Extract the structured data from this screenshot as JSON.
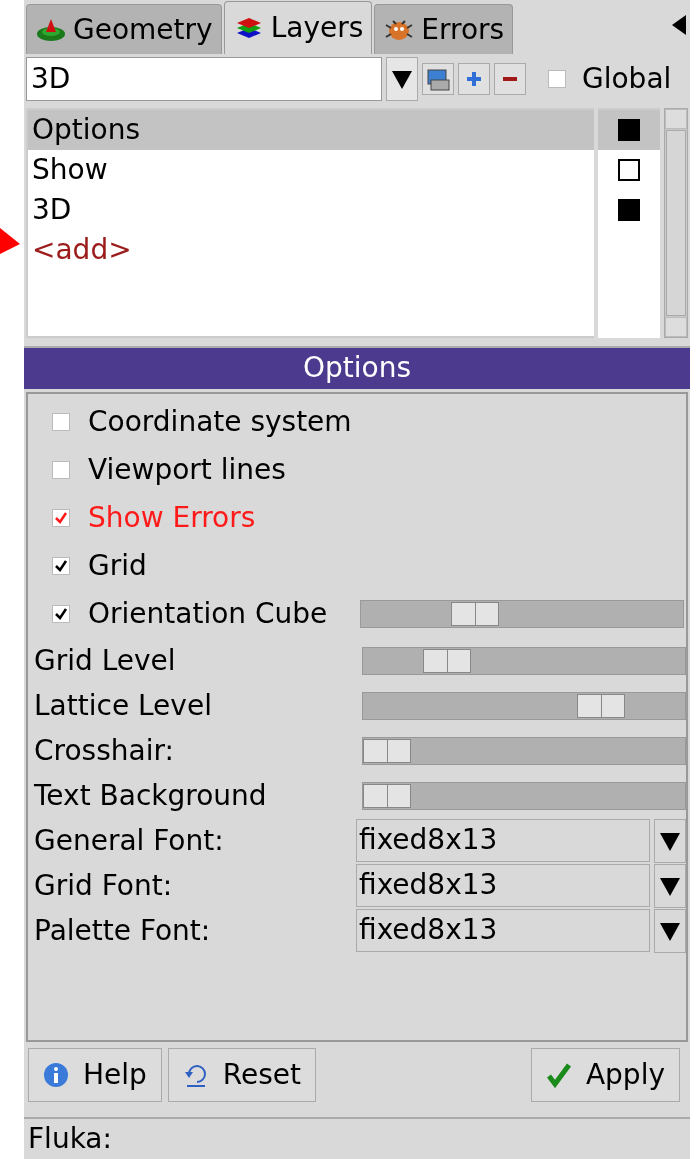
{
  "tabs": [
    {
      "kind": "geometry",
      "label": "Geometry",
      "selected": false
    },
    {
      "kind": "layers",
      "label": "Layers",
      "selected": true
    },
    {
      "kind": "errors",
      "label": "Errors",
      "selected": false
    }
  ],
  "layer_combo": {
    "value": "3D"
  },
  "global": {
    "label": "Global",
    "checked": false
  },
  "layers": [
    {
      "kind": "layer",
      "name": "Options",
      "selected": true,
      "visible": true
    },
    {
      "kind": "layer",
      "name": "Show",
      "selected": false,
      "visible": false
    },
    {
      "kind": "layer",
      "name": "3D",
      "selected": false,
      "visible": true
    },
    {
      "kind": "add",
      "name": "<add>",
      "selected": false
    }
  ],
  "options": {
    "title": "Options",
    "checks": [
      {
        "kind": "check",
        "label": "Coordinate system",
        "checked": false,
        "highlighted": false
      },
      {
        "kind": "check",
        "label": "Viewport lines",
        "checked": false,
        "highlighted": false
      },
      {
        "kind": "check",
        "label": "Show Errors",
        "checked": true,
        "highlighted": true
      },
      {
        "kind": "check",
        "label": "Grid",
        "checked": true,
        "highlighted": false
      },
      {
        "kind": "check_slider",
        "label": "Orientation Cube",
        "checked": true,
        "highlighted": false,
        "level": 0.33
      }
    ],
    "sliders": [
      {
        "label": "Grid Level",
        "level": 0.22
      },
      {
        "label": "Lattice Level",
        "level": 0.78
      },
      {
        "label": "Crosshair:",
        "level": 0
      },
      {
        "label": "Text Background",
        "level": 0
      }
    ],
    "fonts": [
      {
        "label": "General Font:",
        "value": "fixed8x13"
      },
      {
        "label": "Grid Font:",
        "value": "fixed8x13"
      },
      {
        "label": "Palette Font:",
        "value": "fixed8x13"
      }
    ]
  },
  "buttons": [
    {
      "kind": "help",
      "label": "Help"
    },
    {
      "kind": "reset",
      "label": "Reset"
    },
    {
      "kind": "apply",
      "label": "Apply"
    }
  ],
  "status_bar": "Fluka:"
}
